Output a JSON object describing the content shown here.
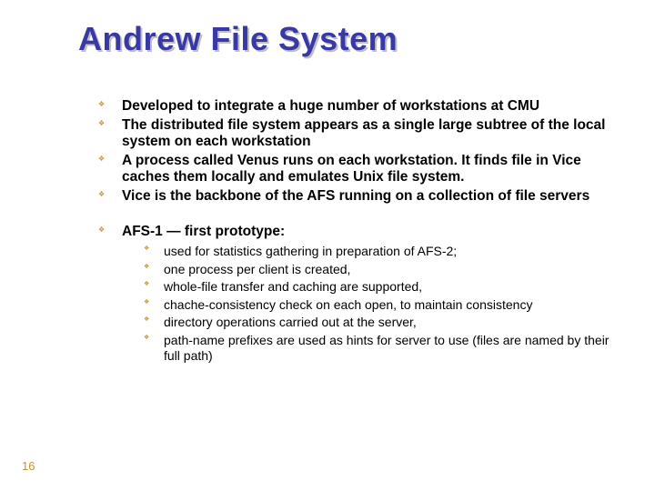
{
  "title": "Andrew File System",
  "bullets": [
    {
      "text": "Developed to integrate a huge number of workstations at CMU"
    },
    {
      "text": "The distributed file system appears as a single large subtree of the local system on each workstation"
    },
    {
      "text": "A process called Venus runs on each workstation. It finds file in Vice caches them locally and emulates Unix file system."
    },
    {
      "text": "Vice is the backbone of the AFS running on a collection of file servers"
    },
    {
      "text": "AFS-1 — first prototype:",
      "gap_before": true,
      "children": [
        "used for statistics gathering in preparation of AFS-2;",
        "one process per client is created,",
        "whole-file transfer and caching are supported,",
        "chache-consistency check on each open, to maintain consistency",
        "directory operations carried out at the server,",
        "path-name prefixes are used as hints for server to use (files are named by their full path)"
      ]
    }
  ],
  "page_number": "16"
}
